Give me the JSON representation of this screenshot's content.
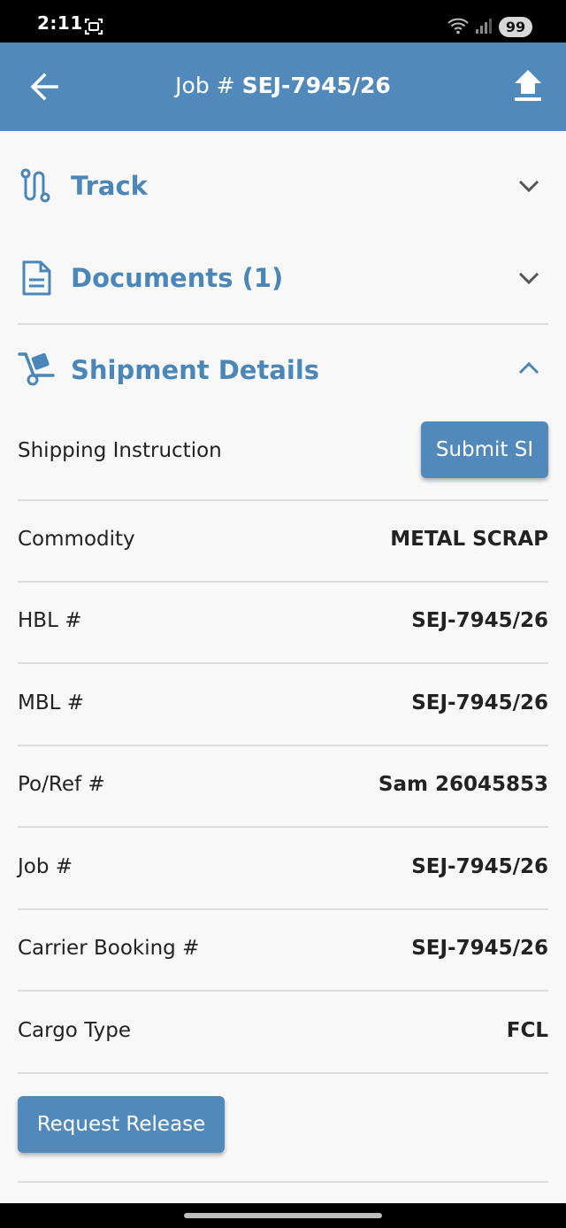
{
  "status_bar": {
    "time": "2:11",
    "battery": "99",
    "icons": [
      "screenshot-icon",
      "wifi-icon",
      "signal-icon",
      "battery-icon"
    ]
  },
  "app_bar": {
    "title_prefix": "Job # ",
    "title_job": "SEJ-7945/26",
    "icons": [
      "back-arrow-icon",
      "upload-icon"
    ]
  },
  "sections": {
    "track": {
      "label": "Track",
      "icon": "route-icon",
      "expanded": false
    },
    "documents": {
      "label": "Documents (1)",
      "icon": "document-icon",
      "expanded": false
    },
    "shipment": {
      "label": "Shipment Details",
      "icon": "hand-truck-icon",
      "expanded": true
    }
  },
  "shipment": {
    "shipping_instruction_label": "Shipping Instruction",
    "submit_si_label": "Submit SI",
    "rows": [
      {
        "label": "Commodity",
        "value": "METAL SCRAP"
      },
      {
        "label": "HBL #",
        "value": "SEJ-7945/26"
      },
      {
        "label": "MBL #",
        "value": "SEJ-7945/26"
      },
      {
        "label": "Po/Ref #",
        "value": "Sam 26045853"
      },
      {
        "label": "Job #",
        "value": "SEJ-7945/26"
      },
      {
        "label": "Carrier Booking #",
        "value": "SEJ-7945/26"
      },
      {
        "label": "Cargo Type",
        "value": "FCL"
      }
    ],
    "request_release_label": "Request Release"
  },
  "colors": {
    "primary": "#5289bb",
    "section_text": "#4b86b9",
    "divider": "#dcdcdc",
    "background": "#f8f8f8"
  }
}
